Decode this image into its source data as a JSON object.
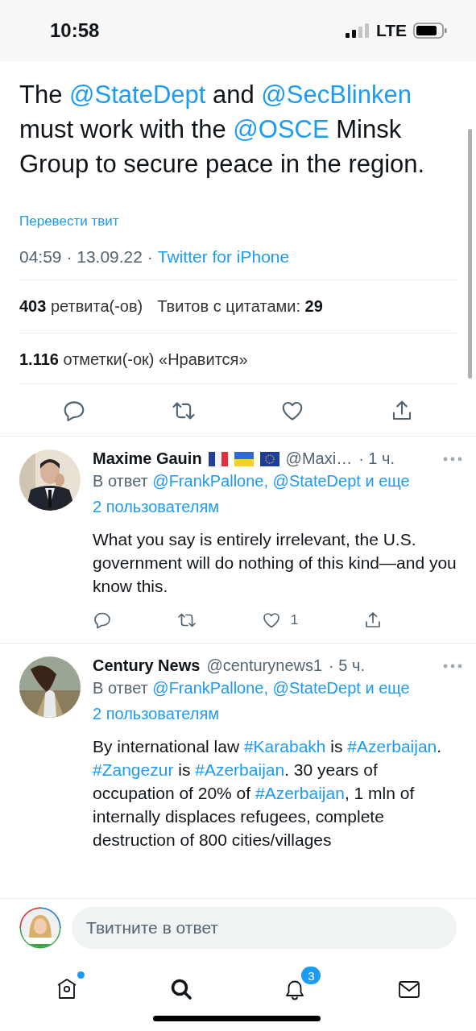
{
  "status_bar": {
    "time": "10:58",
    "network": "LTE"
  },
  "tweet": {
    "text": [
      {
        "kind": "text",
        "text": "The "
      },
      {
        "kind": "mention",
        "text": "@StateDept"
      },
      {
        "kind": "text",
        "text": " and "
      },
      {
        "kind": "mention",
        "text": "@SecBlinken"
      },
      {
        "kind": "text",
        "text": " must work with the "
      },
      {
        "kind": "mention",
        "text": "@OSCE"
      },
      {
        "kind": "text",
        "text": " Minsk Group to secure peace in the region."
      }
    ],
    "translate_link": "Перевести твит",
    "timestamp": "04:59 · 13.09.22 ·",
    "source": "Twitter for iPhone",
    "stats": [
      "**403** ретвита(-ов)",
      "Твитов с цитатами: **29**"
    ],
    "likes": "**1.116** отметки(-ок) «Нравится»"
  },
  "replies": [
    {
      "name": "Maxime Gauin",
      "flags": [
        {
          "kind": "france"
        },
        {
          "kind": "ukraine"
        },
        {
          "kind": "eu"
        }
      ],
      "handle": "@Maxi…",
      "time": "· 1 ч.",
      "reply_to": {
        "prefix": "В ответ",
        "links": [
          "@FrankPallone,",
          "@StateDept",
          "и еще",
          "2 пользователям"
        ]
      },
      "text": [
        {
          "kind": "text",
          "text": "What you say is entirely irrelevant, the U.S. government will do nothing of this kind—and you know this."
        }
      ],
      "like_count": "1"
    },
    {
      "name": "Century News",
      "handle": "@centurynews1",
      "time": "· 5 ч.",
      "reply_to": {
        "prefix": "В ответ",
        "links": [
          "@FrankPallone,",
          "@StateDept",
          "и еще",
          "2 пользователям"
        ]
      },
      "text": [
        {
          "kind": "text",
          "text": "By international law "
        },
        {
          "kind": "hashtag",
          "text": "#Karabakh"
        },
        {
          "kind": "text",
          "text": " is "
        },
        {
          "kind": "hashtag",
          "text": "#Azerbaijan"
        },
        {
          "kind": "text",
          "text": ". "
        },
        {
          "kind": "hashtag",
          "text": "#Zangezur"
        },
        {
          "kind": "text",
          "text": " is "
        },
        {
          "kind": "hashtag",
          "text": "#Azerbaijan"
        },
        {
          "kind": "text",
          "text": ". 30 years of occupation of 20% of "
        },
        {
          "kind": "hashtag",
          "text": "#Azerbaijan"
        },
        {
          "kind": "text",
          "text": ", 1 mln of internally displaces refugees, complete destruction of 800 cities/villages"
        }
      ]
    }
  ],
  "reply_box": {
    "placeholder": "Твитните в ответ"
  },
  "tab_bar": [
    {
      "kind": "home",
      "selected": false,
      "dot": true
    },
    {
      "kind": "search",
      "selected": true,
      "dot": false
    },
    {
      "kind": "notifications",
      "selected": false,
      "dot": false,
      "badge": "3"
    },
    {
      "kind": "messages",
      "selected": false,
      "dot": false
    }
  ]
}
